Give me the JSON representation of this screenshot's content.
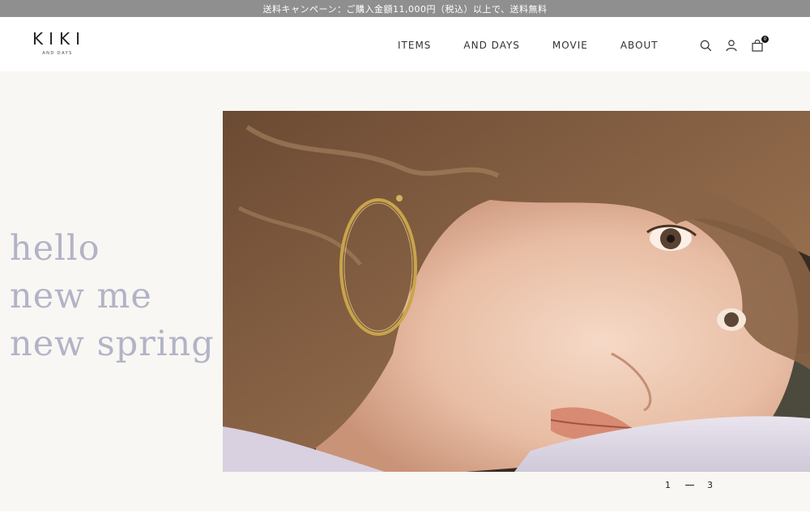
{
  "promo": {
    "text": "送料キャンペーン：ご購入金額11,000円（税込）以上で、送料無料"
  },
  "brand": {
    "name": "KIKI",
    "sub": "AND DAYS"
  },
  "nav": {
    "items": [
      "ITEMS",
      "AND DAYS",
      "MOVIE",
      "ABOUT"
    ]
  },
  "icons": {
    "search": "search-icon",
    "account": "user-icon",
    "cart": "shopping-bag-icon"
  },
  "cart": {
    "count": "0"
  },
  "hero": {
    "lines": [
      "hello",
      "new me",
      "new spring"
    ],
    "tagline_color": "#b3b3c7",
    "background": "#f8f7f3"
  },
  "pager": {
    "current": "1",
    "total": "3"
  }
}
